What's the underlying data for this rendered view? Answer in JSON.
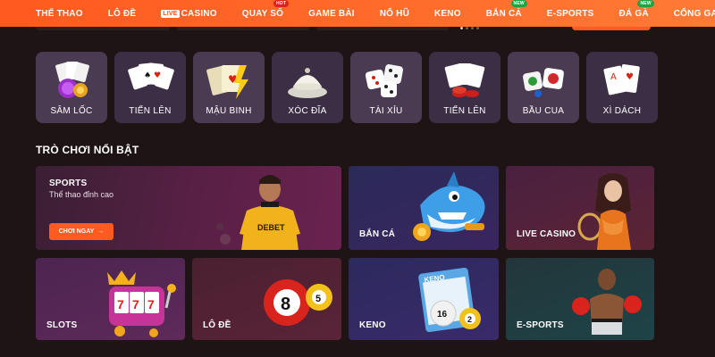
{
  "nav": {
    "items": [
      {
        "label": "THỂ THAO"
      },
      {
        "label": "LÔ ĐỀ"
      },
      {
        "chip": "LIVE",
        "label": "CASINO"
      },
      {
        "label": "QUAY SỐ",
        "badge": "HOT"
      },
      {
        "label": "GAME BÀI"
      },
      {
        "label": "NỔ HŨ"
      },
      {
        "label": "KENO"
      },
      {
        "label": "BẮN CÁ",
        "badge": "NEW"
      },
      {
        "label": "E-SPORTS"
      },
      {
        "label": "ĐÁ GÀ",
        "badge": "NEW"
      },
      {
        "label": "CỔNG GAMES"
      }
    ]
  },
  "categories": [
    {
      "label": "SÂM LỐC"
    },
    {
      "label": "TIẾN LÊN"
    },
    {
      "label": "MẬU BINH"
    },
    {
      "label": "XÓC ĐĨA"
    },
    {
      "label": "TÀI XỈU"
    },
    {
      "label": "TIẾN LÊN"
    },
    {
      "label": "BẦU CUA"
    },
    {
      "label": "XÌ DÁCH"
    }
  ],
  "featured": {
    "title": "TRÒ CHƠI NỔI BẬT",
    "sports": {
      "title": "SPORTS",
      "subtitle": "Thể thao đỉnh cao",
      "button": "CHƠI NGAY",
      "jersey": "DEBET"
    },
    "ban_ca": {
      "title": "BẮN CÁ"
    },
    "live_casino": {
      "title": "LIVE CASINO"
    },
    "slots": {
      "title": "SLOTS"
    },
    "lo_de": {
      "title": "LÔ ĐỀ",
      "ball1": "8",
      "ball2": "5"
    },
    "keno": {
      "title": "KENO",
      "card": "KENO",
      "ball1": "16",
      "ball2": "2"
    },
    "esports": {
      "title": "E-SPORTS"
    }
  },
  "colors": {
    "accent": "#ff5a1f",
    "background": "#1e1416",
    "tile": "#4b3b52"
  }
}
